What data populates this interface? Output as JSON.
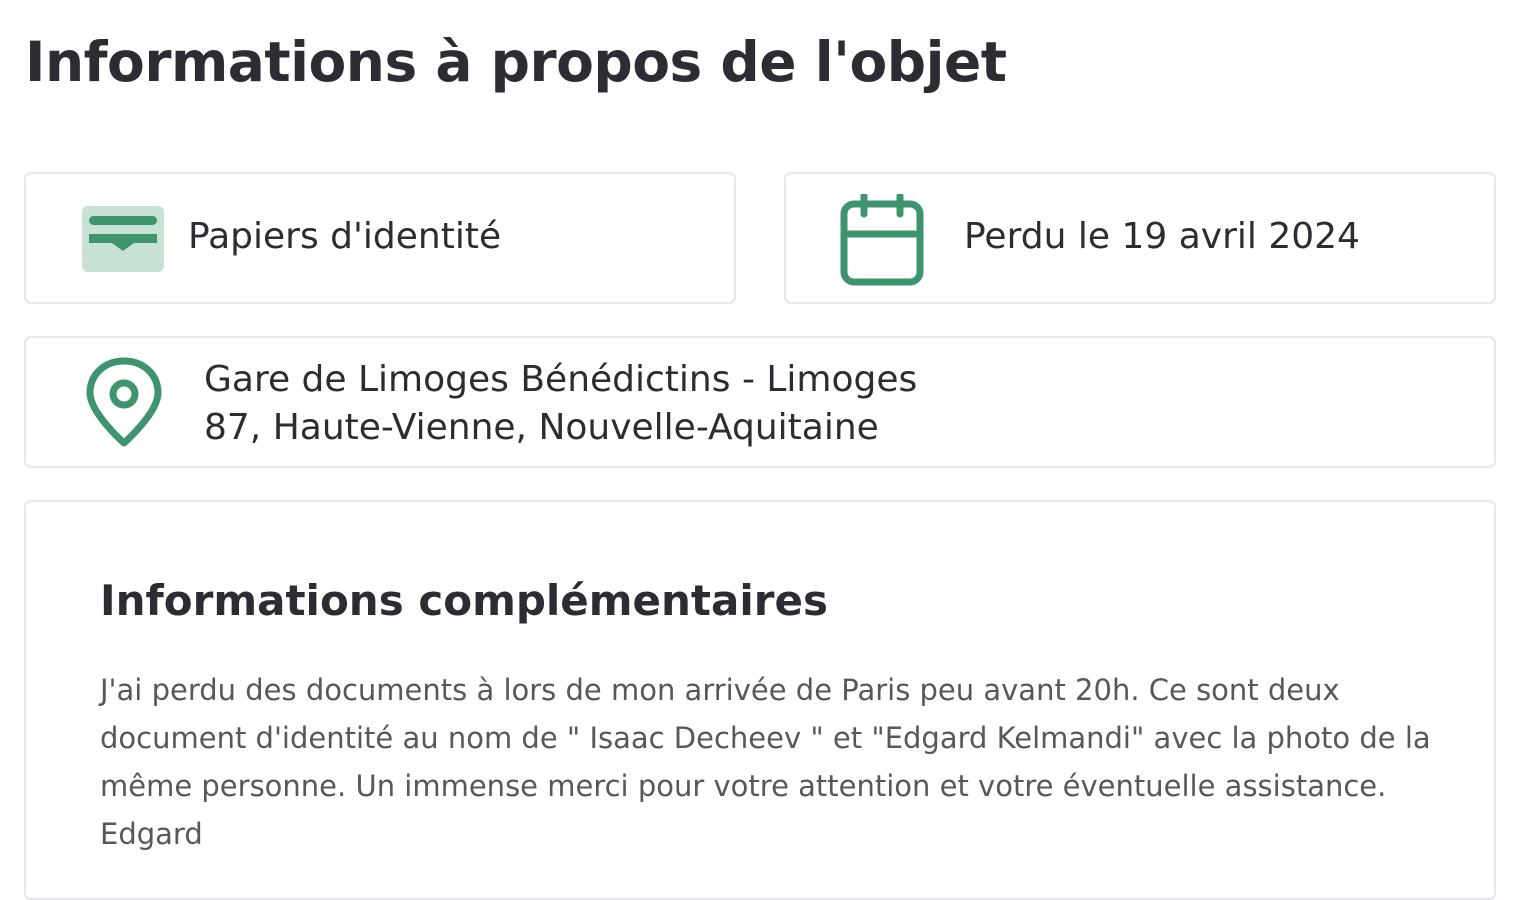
{
  "page": {
    "title": "Informations à propos de l'objet"
  },
  "category": {
    "icon": "id-card-icon",
    "label": "Papiers d'identité"
  },
  "date": {
    "icon": "calendar-icon",
    "label": "Perdu le 19 avril 2024"
  },
  "location": {
    "icon": "map-pin-icon",
    "line1": "Gare de Limoges Bénédictins - Limoges",
    "line2": "87, Haute-Vienne, Nouvelle-Aquitaine"
  },
  "details": {
    "title": "Informations complémentaires",
    "lines": [
      "J'ai perdu des documents à lors de mon arrivée de Paris peu avant 20h. Ce sont deux",
      "document d'identité au nom de \" Isaac Decheev \" et \"Edgard Kelmandi\" avec la photo de la",
      "même personne. Un immense merci pour votre attention et votre éventuelle assistance.",
      "Edgard"
    ]
  },
  "colors": {
    "accent": "#3f9470",
    "accent_light": "#c7e1d5",
    "border": "#e6e7ea",
    "text": "#2b2d33",
    "muted_text": "#55585e"
  }
}
